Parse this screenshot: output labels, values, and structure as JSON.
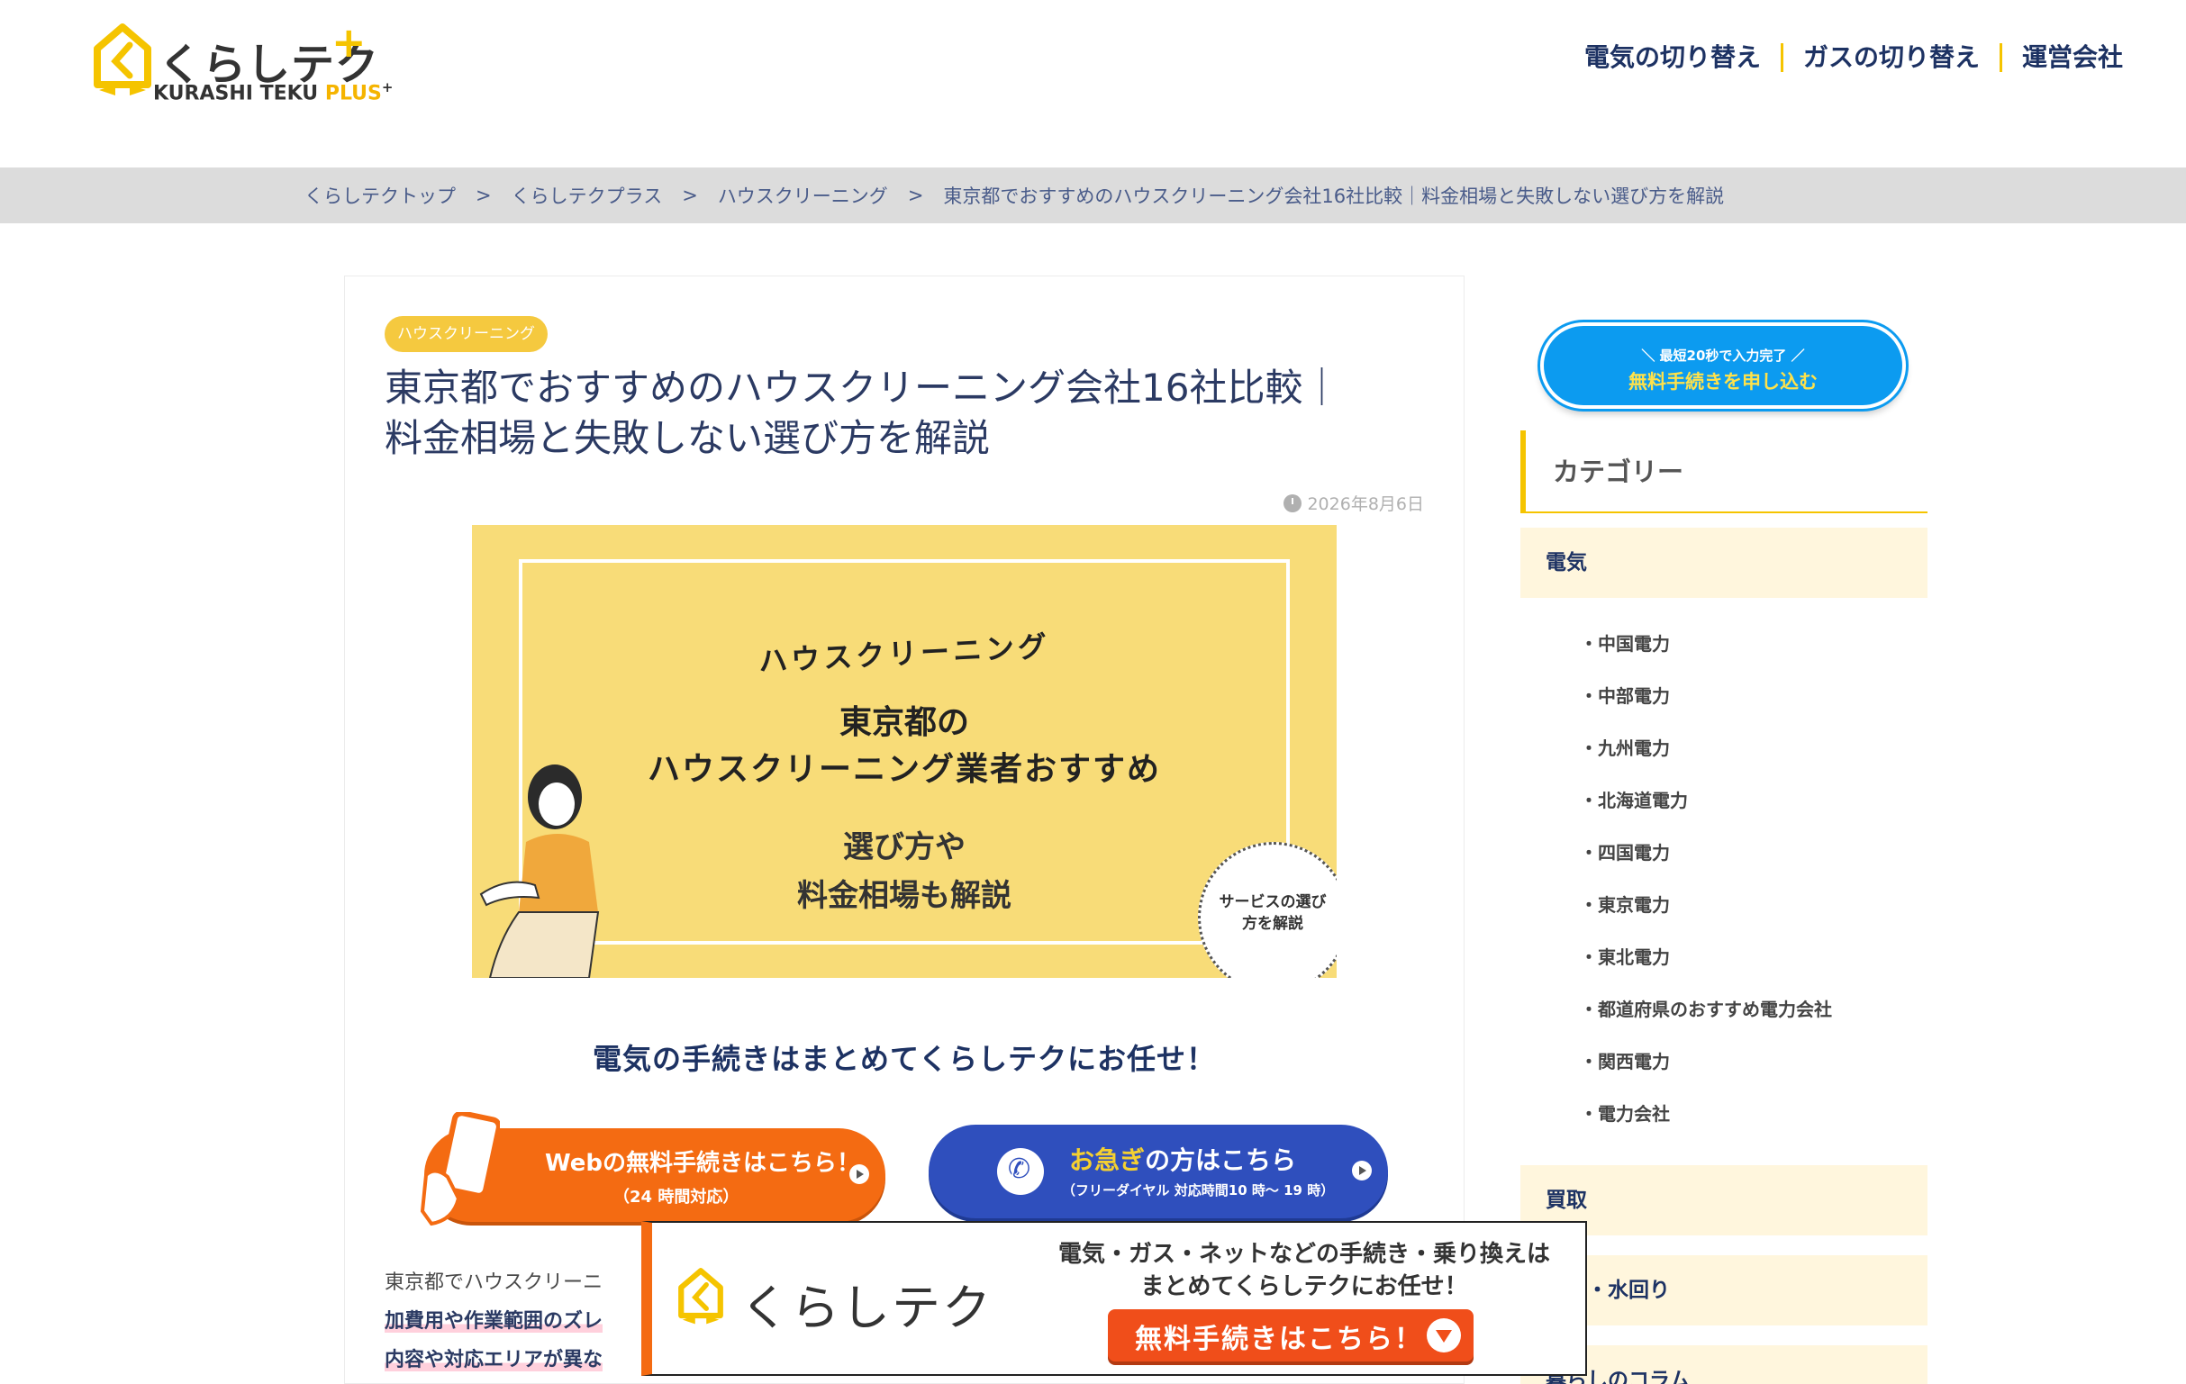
{
  "header": {
    "logo_text": "くらしテク",
    "logo_sub": "KURASHI TEKU",
    "logo_sub_plus": "PLUS",
    "logo_sub_sup": "+",
    "nav": [
      "電気の切り替え",
      "ガスの切り替え",
      "運営会社"
    ]
  },
  "breadcrumb": {
    "items": [
      "くらしテクトップ",
      "くらしテクプラス",
      "ハウスクリーニング",
      "東京都でおすすめのハウスクリーニング会社16社比較｜料金相場と失敗しない選び方を解説"
    ],
    "separator": ">"
  },
  "article": {
    "category_badge": "ハウスクリーニング",
    "title_line1": "東京都でおすすめのハウスクリーニング会社16社比較｜",
    "title_line2": "料金相場と失敗しない選び方を解説",
    "date": "2026年8月6日",
    "eyecatch": {
      "kicker": "ハウスクリーニング",
      "line1": "東京都の",
      "line2": "ハウスクリーニング業者おすすめ",
      "line3": "選び方や",
      "line4": "料金相場も解説",
      "stamp": "サービスの選び方を解説"
    },
    "promo_heading": "電気の手続きはまとめてくらしテクにお任せ！",
    "cta_web": {
      "line1": "Webの無料手続きはこちら！",
      "line2": "（24 時間対応）"
    },
    "cta_tel": {
      "line1_hl": "お急ぎ",
      "line1_rest": "の方はこちら",
      "line2": "（フリーダイヤル 対応時間10 時〜 19 時）"
    },
    "intro_line1": "東京都でハウスクリーニ",
    "intro_line2": "加費用や作業範囲のズレ",
    "intro_line3": "内容や対応エリアが異な"
  },
  "sidebar": {
    "cta_small": "＼ 最短20秒で入力完了 ／",
    "cta_main": "無料手続きを申し込む",
    "category_heading": "カテゴリー",
    "groups": [
      "電気",
      "買取",
      "汚れ・水回り",
      "暮らしのコラム"
    ],
    "sub_items": [
      "・中国電力",
      "・中部電力",
      "・九州電力",
      "・北海道電力",
      "・四国電力",
      "・東京電力",
      "・東北電力",
      "・都道府県のおすすめ電力会社",
      "・関西電力",
      "・電力会社"
    ]
  },
  "float_banner": {
    "logo_text": "くらしテク",
    "text1": "電気・ガス・ネットなどの手続き・乗り換えは",
    "text2": "まとめてくらしテクにお任せ！",
    "button": "無料手続きはこちら！"
  },
  "colors": {
    "brand_yellow": "#f5c400",
    "navy": "#1d3263",
    "orange": "#f46b12",
    "blue": "#2f4fbd",
    "sky": "#0c9bf0"
  }
}
